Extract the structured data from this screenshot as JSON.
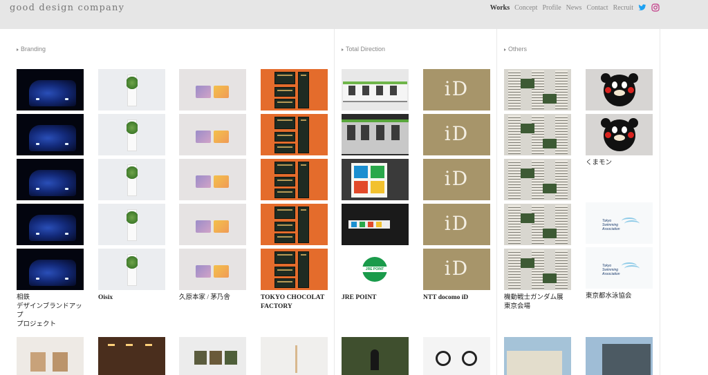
{
  "header": {
    "logo": "good design company",
    "nav": [
      {
        "label": "Works",
        "active": true
      },
      {
        "label": "Concept",
        "active": false
      },
      {
        "label": "Profile",
        "active": false
      },
      {
        "label": "News",
        "active": false
      },
      {
        "label": "Contact",
        "active": false
      },
      {
        "label": "Recruit",
        "active": false
      }
    ],
    "social": [
      "twitter-icon",
      "instagram-icon"
    ]
  },
  "sections": {
    "branding": "Branding",
    "total_direction": "Total Direction",
    "others": "Others"
  },
  "works": [
    {
      "caption": "相鉄\nデザインブランドアップ\nプロジェクト",
      "thumb": "train-night"
    },
    {
      "caption": "Oisix",
      "thumb": "oisix-package"
    },
    {
      "caption": "久原本家 / 茅乃舎",
      "thumb": "soap-blocks"
    },
    {
      "caption": "TOKYO CHOCOLAT FACTORY",
      "thumb": "chocolate-boxes"
    },
    {
      "caption": "JRE POINT",
      "thumb": "jr-train"
    },
    {
      "caption": "NTT docomo iD",
      "thumb": "id-logo"
    },
    {
      "caption": "機動戦士ガンダム展\n東京会場",
      "thumb": "newspaper"
    },
    {
      "caption": "くまモン",
      "thumb": "kumamon"
    },
    {
      "caption": "東京都水泳協会",
      "thumb": "swimming-association"
    }
  ],
  "thumb_text": {
    "id_logo": "iD",
    "jre_point": "JRE POINT",
    "swim_line1": "Tokyo",
    "swim_line2": "Swimming",
    "swim_line3": "Association"
  },
  "colors": {
    "header_bg": "#e6e6e6",
    "twitter": "#1da1f2",
    "instagram": "#c13584",
    "active_nav": "#333333"
  }
}
